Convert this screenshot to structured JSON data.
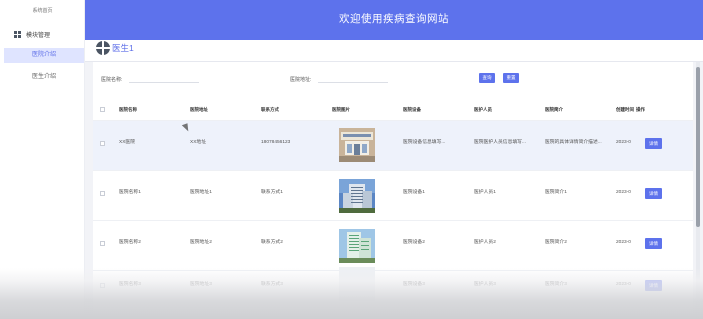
{
  "sidebar": {
    "home_label": "系统首页",
    "module_label": "模块管理",
    "items": [
      {
        "label": "医院介绍",
        "active": true
      },
      {
        "label": "医生介绍",
        "active": false
      }
    ]
  },
  "header": {
    "title": "欢迎使用疾病查询网站"
  },
  "breadcrumb": {
    "label": "医生1"
  },
  "search": {
    "name_label": "医院名称:",
    "name_value": "",
    "address_label": "医院地址:",
    "address_value": "",
    "search_button": "查询",
    "reset_button": "重置"
  },
  "table": {
    "columns": [
      "医院名称",
      "医院地址",
      "联系方式",
      "医院图片",
      "医院设备",
      "医护人员",
      "医院简介",
      "创建时间",
      "操作"
    ],
    "rows": [
      {
        "name": "XX医院",
        "address": "XX地址",
        "phone": "18078456123",
        "equipment": "医院设备信息填写...",
        "staff": "医院医护人员信息填写...",
        "intro": "医院的具体详情简介描述...",
        "created": "2023-0",
        "action": "详情"
      },
      {
        "name": "医院名称1",
        "address": "医院地址1",
        "phone": "联系方式1",
        "equipment": "医院设备1",
        "staff": "医护人员1",
        "intro": "医院简介1",
        "created": "2023-0",
        "action": "详情"
      },
      {
        "name": "医院名称2",
        "address": "医院地址2",
        "phone": "联系方式2",
        "equipment": "医院设备2",
        "staff": "医护人员2",
        "intro": "医院简介2",
        "created": "2023-0",
        "action": "详情"
      },
      {
        "name": "医院名称3",
        "address": "医院地址3",
        "phone": "联系方式3",
        "equipment": "医院设备3",
        "staff": "医护人员3",
        "intro": "医院简介3",
        "created": "2023-0",
        "action": "详情"
      }
    ]
  },
  "colors": {
    "primary": "#5d72ec",
    "active_bg": "#dfe4ff",
    "row_highlight": "#eef2fb"
  },
  "icons": {
    "module": "grid-icon",
    "breadcrumb": "hospital-icon"
  }
}
